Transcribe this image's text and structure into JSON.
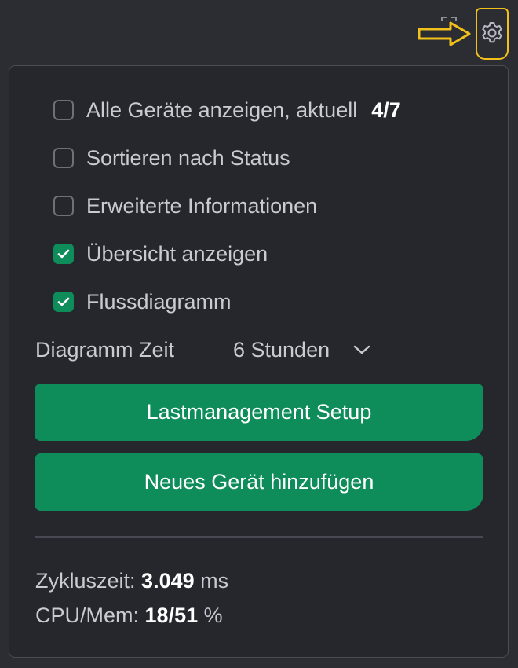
{
  "options": [
    {
      "label": "Alle Geräte anzeigen, aktuell",
      "checked": false,
      "count": "4/7"
    },
    {
      "label": "Sortieren nach Status",
      "checked": false
    },
    {
      "label": "Erweiterte Informationen",
      "checked": false
    },
    {
      "label": "Übersicht anzeigen",
      "checked": true
    },
    {
      "label": "Flussdiagramm",
      "checked": true
    }
  ],
  "diagram_time": {
    "label": "Diagramm Zeit",
    "value": "6 Stunden"
  },
  "buttons": {
    "setup": "Lastmanagement Setup",
    "add_device": "Neues Gerät hinzufügen"
  },
  "stats": {
    "cycle_label": "Zykluszeit:",
    "cycle_value": "3.049",
    "cycle_unit": "ms",
    "cpu_label": "CPU/Mem:",
    "cpu_value": "18/51",
    "cpu_unit": "%"
  },
  "colors": {
    "accent_green": "#0e8c5a",
    "highlight_yellow": "#f2c01b",
    "panel_bg": "#25272c"
  },
  "icons": {
    "settings": "gear-icon",
    "annotation": "arrow-right-icon",
    "collapse": "corner-brackets-icon",
    "dropdown": "chevron-down-icon",
    "checkmark": "check-icon"
  }
}
